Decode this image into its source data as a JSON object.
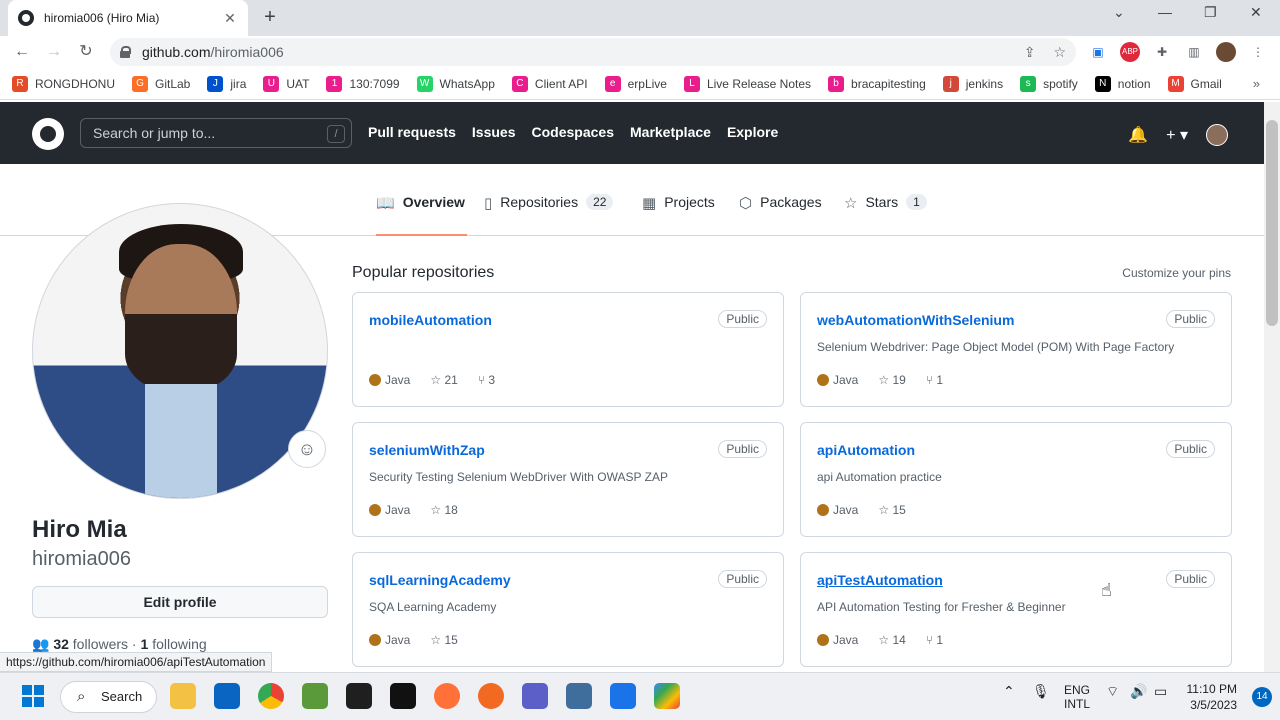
{
  "browser": {
    "tab_title": "hiromia006 (Hiro Mia)",
    "tab_close": "✕",
    "new_tab": "+",
    "url_host": "github.com",
    "url_path": "/hiromia006",
    "window_controls": [
      "⌄",
      "—",
      "❐",
      "✕"
    ]
  },
  "bookmarks": [
    {
      "label": "RONGDHONU",
      "color": "#e34c26",
      "icon": "R"
    },
    {
      "label": "GitLab",
      "color": "#fc6d26",
      "icon": "G"
    },
    {
      "label": "jira",
      "color": "#0052cc",
      "icon": "J"
    },
    {
      "label": "UAT",
      "color": "#e91e8c",
      "icon": "U"
    },
    {
      "label": "130:7099",
      "color": "#e91e8c",
      "icon": "1"
    },
    {
      "label": "WhatsApp",
      "color": "#25d366",
      "icon": "W"
    },
    {
      "label": "Client API",
      "color": "#e91e8c",
      "icon": "C"
    },
    {
      "label": "erpLive",
      "color": "#e91e8c",
      "icon": "e"
    },
    {
      "label": "Live Release Notes",
      "color": "#e91e8c",
      "icon": "L"
    },
    {
      "label": "bracapitesting",
      "color": "#e91e8c",
      "icon": "b"
    },
    {
      "label": "jenkins",
      "color": "#d24939",
      "icon": "j"
    },
    {
      "label": "spotify",
      "color": "#1db954",
      "icon": "s"
    },
    {
      "label": "notion",
      "color": "#000000",
      "icon": "N"
    },
    {
      "label": "Gmail",
      "color": "#ea4335",
      "icon": "M"
    }
  ],
  "bookmarks_more": "»",
  "github": {
    "search_placeholder": "Search or jump to...",
    "search_key": "/",
    "nav": [
      "Pull requests",
      "Issues",
      "Codespaces",
      "Marketplace",
      "Explore"
    ]
  },
  "profile_tabs": [
    {
      "label": "Overview",
      "icon": "book-icon",
      "glyph": "📖",
      "count": ""
    },
    {
      "label": "Repositories",
      "icon": "repo-icon",
      "glyph": "▯",
      "count": "22"
    },
    {
      "label": "Projects",
      "icon": "table-icon",
      "glyph": "▦",
      "count": ""
    },
    {
      "label": "Packages",
      "icon": "package-icon",
      "glyph": "⬡",
      "count": ""
    },
    {
      "label": "Stars",
      "icon": "star-icon",
      "glyph": "☆",
      "count": "1"
    }
  ],
  "profile": {
    "name": "Hiro Mia",
    "login": "hiromia006",
    "edit_label": "Edit profile",
    "followers": "32",
    "followers_label": "followers",
    "following": "1",
    "following_label": "following"
  },
  "pinned": {
    "title": "Popular repositories",
    "customize": "Customize your pins",
    "repos": [
      {
        "name": "mobileAutomation",
        "visibility": "Public",
        "desc": "",
        "lang": "Java",
        "stars": "21",
        "forks": "3"
      },
      {
        "name": "webAutomationWithSelenium",
        "visibility": "Public",
        "desc": "Selenium Webdriver: Page Object Model (POM) With Page Factory",
        "lang": "Java",
        "stars": "19",
        "forks": "1"
      },
      {
        "name": "seleniumWithZap",
        "visibility": "Public",
        "desc": "Security Testing Selenium WebDriver With OWASP ZAP",
        "lang": "Java",
        "stars": "18",
        "forks": ""
      },
      {
        "name": "apiAutomation",
        "visibility": "Public",
        "desc": "api Automation practice",
        "lang": "Java",
        "stars": "15",
        "forks": ""
      },
      {
        "name": "sqlLearningAcademy",
        "visibility": "Public",
        "desc": "SQA Learning Academy",
        "lang": "Java",
        "stars": "15",
        "forks": ""
      },
      {
        "name": "apiTestAutomation",
        "visibility": "Public",
        "desc": "API Automation Testing for Fresher & Beginner",
        "lang": "Java",
        "stars": "14",
        "forks": "1"
      }
    ]
  },
  "status_url": "https://github.com/hiromia006/apiTestAutomation",
  "taskbar": {
    "search_label": "Search",
    "lang_top": "ENG",
    "lang_bottom": "INTL",
    "time": "11:10 PM",
    "date": "3/5/2023",
    "notifications": "14"
  }
}
